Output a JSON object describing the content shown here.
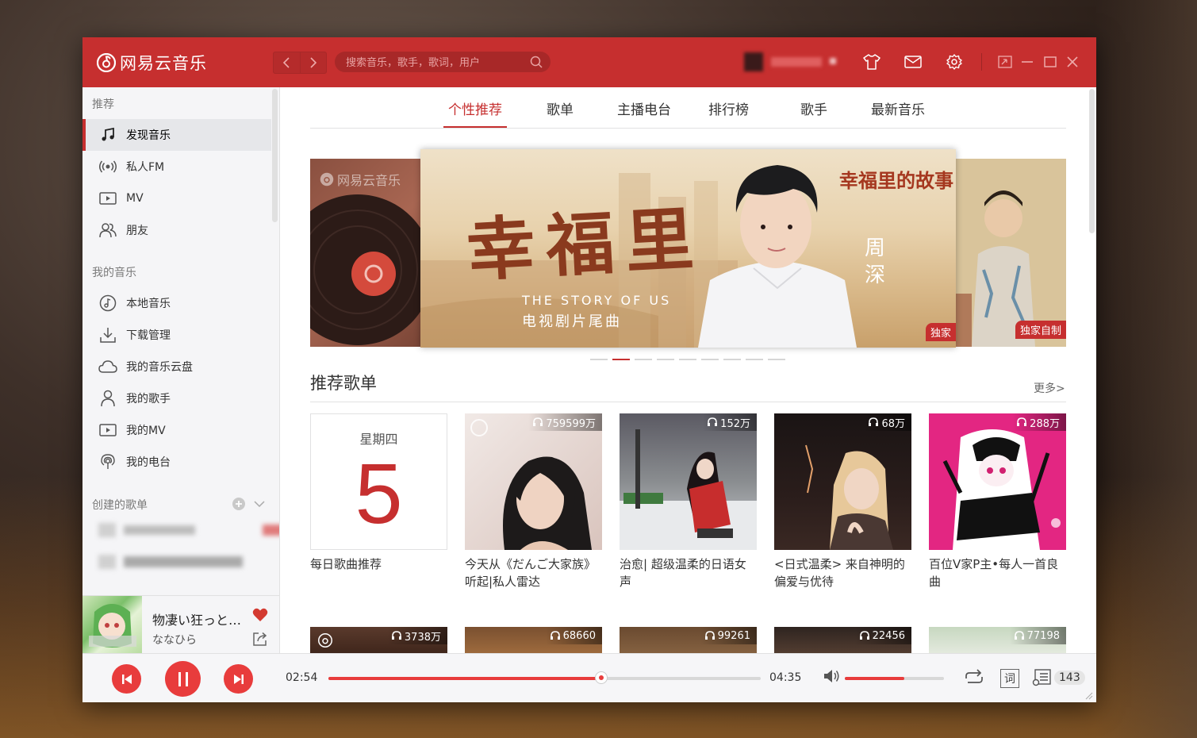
{
  "app": {
    "name": "网易云音乐"
  },
  "colors": {
    "brand": "#c62f2f",
    "accent": "#e83c3c"
  },
  "search": {
    "placeholder": "搜索音乐，歌手，歌词，用户"
  },
  "sidebar": {
    "section_recommend": "推荐",
    "recommend_items": [
      {
        "label": "发现音乐",
        "icon": "music-note-icon",
        "active": true
      },
      {
        "label": "私人FM",
        "icon": "radio-icon"
      },
      {
        "label": "MV",
        "icon": "video-icon"
      },
      {
        "label": "朋友",
        "icon": "friends-icon"
      }
    ],
    "section_my_music": "我的音乐",
    "my_music_items": [
      {
        "label": "本地音乐",
        "icon": "local-music-icon"
      },
      {
        "label": "下载管理",
        "icon": "download-icon"
      },
      {
        "label": "我的音乐云盘",
        "icon": "cloud-icon"
      },
      {
        "label": "我的歌手",
        "icon": "singer-icon"
      },
      {
        "label": "我的MV",
        "icon": "video-icon"
      },
      {
        "label": "我的电台",
        "icon": "podcast-icon"
      }
    ],
    "section_created": "创建的歌单"
  },
  "now_playing": {
    "title": "物凄い狂っとる...",
    "artist": "ななひら"
  },
  "tabs": [
    {
      "label": "个性推荐",
      "active": true
    },
    {
      "label": "歌单"
    },
    {
      "label": "主播电台"
    },
    {
      "label": "排行榜"
    },
    {
      "label": "歌手"
    },
    {
      "label": "最新音乐"
    }
  ],
  "banner": {
    "watermark": "网易云音乐",
    "main_title": "幸福里",
    "main_subtitle_en": "THE STORY OF US",
    "main_subtitle_cn": "电视剧片尾曲",
    "logo_text": "幸福里的故事",
    "artist": "周深",
    "main_badge": "独家",
    "right_badge": "独家自制",
    "dots_total": 9,
    "dot_active": 2
  },
  "recommended_playlists": {
    "title": "推荐歌单",
    "more": "更多>",
    "daily": {
      "weekday": "星期四",
      "day": "5",
      "title": "每日歌曲推荐"
    },
    "items": [
      {
        "count": "759599万",
        "title": "今天从《だんご大家族》听起|私人雷达"
      },
      {
        "count": "152万",
        "title": "治愈| 超级温柔的日语女声"
      },
      {
        "count": "68万",
        "title": "<日式温柔> 来自神明的偏爱与优待"
      },
      {
        "count": "288万",
        "title": "百位V家P主•每人一首良曲"
      }
    ],
    "row2_counts": [
      "3738万",
      "68660",
      "99261",
      "22456",
      "77198"
    ]
  },
  "player": {
    "current_time": "02:54",
    "total_time": "04:35",
    "progress": 0.63,
    "volume": 0.6,
    "lyrics_label": "词",
    "playlist_count": "143"
  }
}
